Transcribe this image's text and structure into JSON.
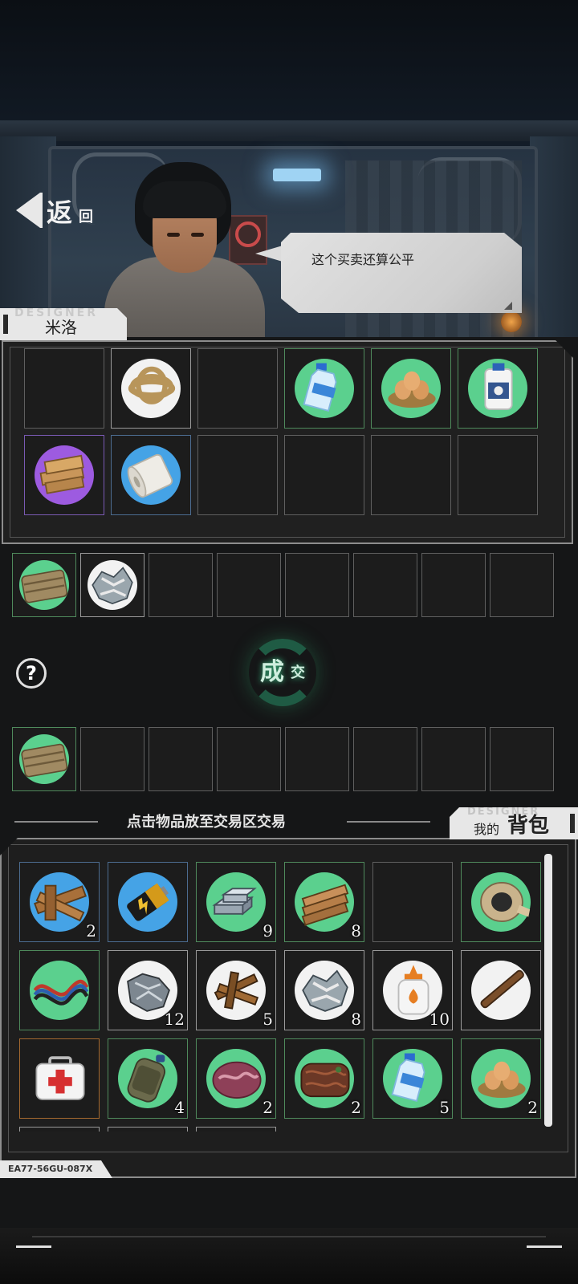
{
  "back_button": {
    "main": "返",
    "sub": "回"
  },
  "npc": {
    "name": "米洛",
    "name_watermark": "DESIGNER",
    "dialogue": "这个买卖还算公平"
  },
  "merchant_inventory": [
    {
      "icon": "empty-slot",
      "rarity": "none"
    },
    {
      "icon": "rope-icon",
      "rarity": "white"
    },
    {
      "icon": "empty-slot",
      "rarity": "none"
    },
    {
      "icon": "water-bottle-icon",
      "rarity": "green"
    },
    {
      "icon": "eggs-nest-icon",
      "rarity": "green"
    },
    {
      "icon": "milk-jug-icon",
      "rarity": "green"
    },
    {
      "icon": "wood-blocks-icon",
      "rarity": "purple"
    },
    {
      "icon": "bandage-roll-icon",
      "rarity": "blue"
    },
    {
      "icon": "empty-slot",
      "rarity": "none"
    },
    {
      "icon": "empty-slot",
      "rarity": "none"
    },
    {
      "icon": "empty-slot",
      "rarity": "none"
    },
    {
      "icon": "empty-slot",
      "rarity": "none"
    }
  ],
  "merchant_offer": [
    {
      "icon": "burlap-cloth-icon",
      "rarity": "green"
    },
    {
      "icon": "scrap-cloth-icon",
      "rarity": "white"
    },
    {
      "icon": "empty-slot",
      "rarity": "none"
    },
    {
      "icon": "empty-slot",
      "rarity": "none"
    },
    {
      "icon": "empty-slot",
      "rarity": "none"
    },
    {
      "icon": "empty-slot",
      "rarity": "none"
    },
    {
      "icon": "empty-slot",
      "rarity": "none"
    },
    {
      "icon": "empty-slot",
      "rarity": "none"
    }
  ],
  "trade": {
    "help_icon": "question-icon",
    "deal_main": "成",
    "deal_sub": "交"
  },
  "player_offer": [
    {
      "icon": "burlap-cloth-icon",
      "rarity": "green"
    },
    {
      "icon": "empty-slot",
      "rarity": "none"
    },
    {
      "icon": "empty-slot",
      "rarity": "none"
    },
    {
      "icon": "empty-slot",
      "rarity": "none"
    },
    {
      "icon": "empty-slot",
      "rarity": "none"
    },
    {
      "icon": "empty-slot",
      "rarity": "none"
    },
    {
      "icon": "empty-slot",
      "rarity": "none"
    },
    {
      "icon": "empty-slot",
      "rarity": "none"
    }
  ],
  "hint": "点击物品放至交易区交易",
  "backpack": {
    "title_small": "我的",
    "title_big": "背包",
    "watermark": "DESIGNER",
    "items": [
      {
        "icon": "wood-planks-icon",
        "rarity": "blue",
        "count": "2"
      },
      {
        "icon": "battery-icon",
        "rarity": "blue",
        "count": ""
      },
      {
        "icon": "metal-ingots-icon",
        "rarity": "green",
        "count": "9"
      },
      {
        "icon": "lumber-icon",
        "rarity": "green",
        "count": "8"
      },
      {
        "icon": "empty-slot",
        "rarity": "none",
        "count": ""
      },
      {
        "icon": "duct-tape-icon",
        "rarity": "green",
        "count": ""
      },
      {
        "icon": "wires-icon",
        "rarity": "green",
        "count": ""
      },
      {
        "icon": "scrap-metal-icon",
        "rarity": "white",
        "count": "12"
      },
      {
        "icon": "scrap-wood-icon",
        "rarity": "white",
        "count": "5"
      },
      {
        "icon": "scrap-cloth-icon",
        "rarity": "white",
        "count": "8"
      },
      {
        "icon": "glue-bottle-icon",
        "rarity": "white",
        "count": "10"
      },
      {
        "icon": "stick-icon",
        "rarity": "white",
        "count": ""
      },
      {
        "icon": "medkit-icon",
        "rarity": "orange",
        "count": ""
      },
      {
        "icon": "canteen-icon",
        "rarity": "green",
        "count": "4"
      },
      {
        "icon": "raw-meat-icon",
        "rarity": "green",
        "count": "2"
      },
      {
        "icon": "cooked-meat-icon",
        "rarity": "green",
        "count": "2"
      },
      {
        "icon": "water-bottle-icon",
        "rarity": "green",
        "count": "5"
      },
      {
        "icon": "eggs-nest-icon",
        "rarity": "green",
        "count": "2"
      }
    ]
  },
  "footer_code": "EA77-56GU-087X",
  "colors": {
    "green": "#5bd08e",
    "blue": "#45a3e6",
    "purple": "#9d5be0",
    "orange": "#d0863e",
    "white": "#f2f2f2",
    "deal_glow": "#39c487"
  }
}
